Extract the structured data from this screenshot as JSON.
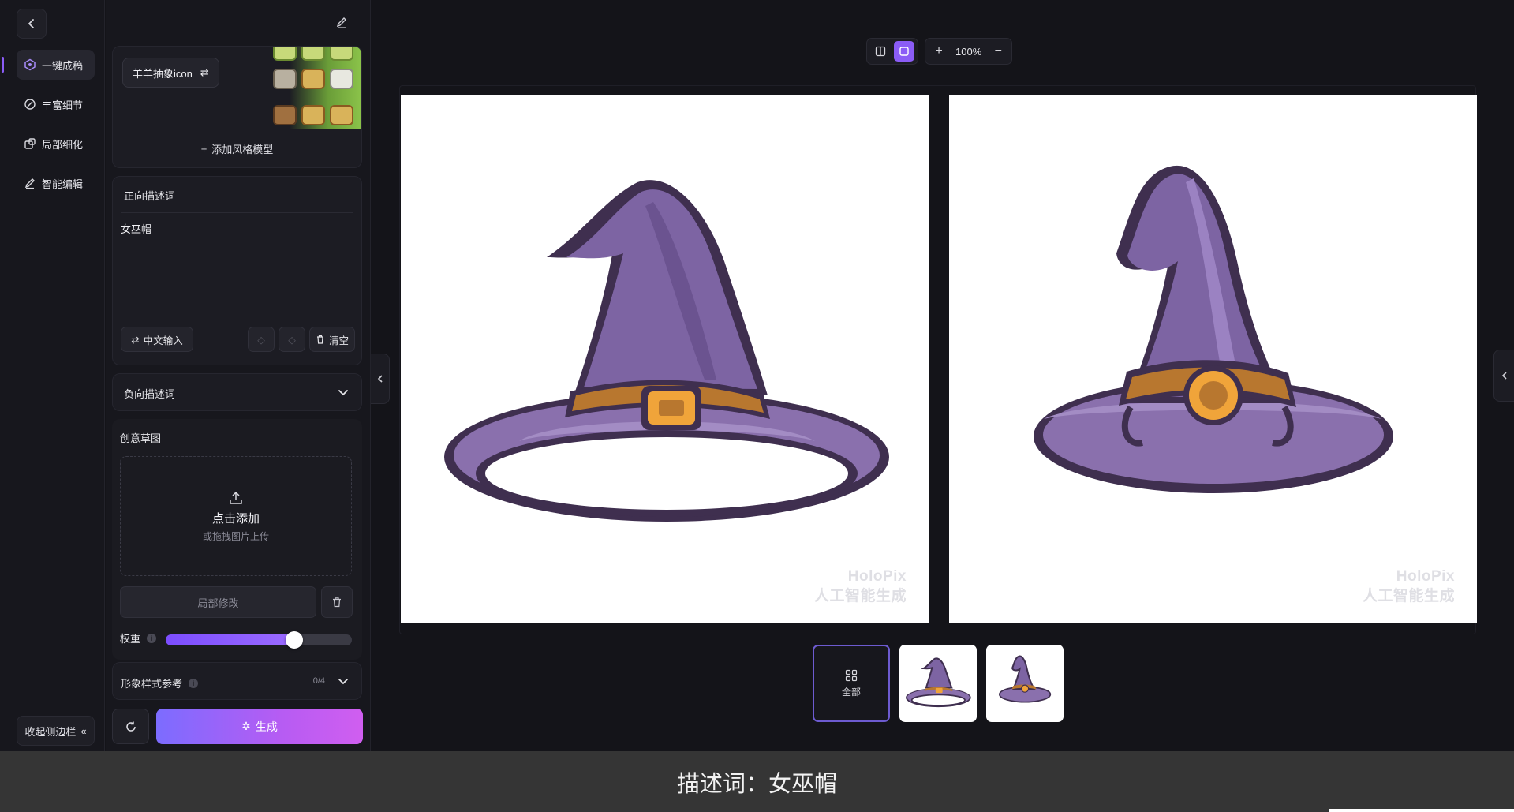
{
  "rail": {
    "back_icon": "chevron-left-icon",
    "items": [
      {
        "label": "一键成稿",
        "icon": "cube-icon",
        "active": true
      },
      {
        "label": "丰富细节",
        "icon": "detail-icon",
        "active": false
      },
      {
        "label": "局部细化",
        "icon": "region-icon",
        "active": false
      },
      {
        "label": "智能编辑",
        "icon": "pen-icon",
        "active": false
      }
    ],
    "collapse_label": "收起侧边栏",
    "accent_color": "#8b5cf6"
  },
  "panel": {
    "style_model": {
      "name": "羊羊抽象icon",
      "add_label": "添加风格模型"
    },
    "positive_prompt": {
      "title": "正向描述词",
      "value": "女巫帽",
      "chinese_input_label": "中文输入",
      "clear_label": "清空"
    },
    "negative_prompt": {
      "title": "负向描述词"
    },
    "sketch": {
      "title": "创意草图",
      "upload_main": "点击添加",
      "upload_hint": "或拖拽图片上传",
      "local_edit_label": "局部修改",
      "weight_label": "权重",
      "weight_value": 0.71
    },
    "style_reference": {
      "title": "形象样式参考",
      "count": "0/4"
    },
    "generate_label": "生成",
    "generate_gradient": [
      "#7c6cff",
      "#d05ef0"
    ]
  },
  "toolbar": {
    "zoom": "100%"
  },
  "canvas": {
    "images": [
      {
        "alt": "witch-hat-1",
        "watermark_line1": "HoloPix",
        "watermark_line2": "人工智能生成"
      },
      {
        "alt": "witch-hat-2",
        "watermark_line1": "HoloPix",
        "watermark_line2": "人工智能生成"
      }
    ]
  },
  "thumbnails": {
    "all_label": "全部"
  },
  "caption": "描述词：女巫帽"
}
